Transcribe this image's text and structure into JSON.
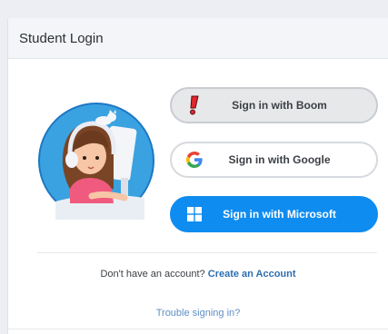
{
  "login": {
    "title": "Student Login",
    "buttons": {
      "boom": "Sign in with Boom",
      "google": "Sign in with Google",
      "microsoft": "Sign in with Microsoft"
    },
    "signup_prompt": "Don't have an account?",
    "signup_link": "Create an Account",
    "trouble_link": "Trouble signing in?"
  },
  "icons": {
    "avatar": "student-with-headphones-avatar",
    "boom": "boom-logo-icon",
    "google": "google-g-icon",
    "microsoft": "windows-logo-icon"
  },
  "colors": {
    "microsoft_button": "#0f8cf0",
    "link": "#2e6fb0",
    "avatar_bg": "#3aa2e0"
  }
}
